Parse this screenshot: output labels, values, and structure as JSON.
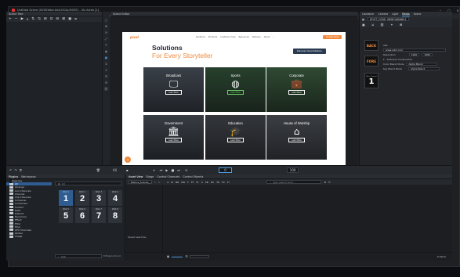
{
  "window": {
    "title": "Untitled Scene (SVGEditor.txt/LOCAL/HOST) - Viz Artist [1]",
    "controls": [
      "–",
      "□",
      "✕"
    ]
  },
  "menubar": {
    "workspace": "Workspace: Default",
    "items": [
      "Import",
      "Archive",
      "Post",
      "Config",
      "On Air"
    ]
  },
  "scene_tree": {
    "title": "Scene Tree",
    "toolbar_icons": [
      "+",
      "−",
      "▶",
      "⏸",
      "⇅",
      "⇆",
      "⊞",
      "⊡",
      "⊟",
      "⊠",
      "▣",
      "⌗"
    ]
  },
  "scene_editor": {
    "title": "Scene Editor"
  },
  "website": {
    "logo": "pixel",
    "nav": [
      "Solutions",
      "Products",
      "Customer Care",
      "Resources",
      "Partners",
      "About"
    ],
    "header_button": "Contact Sales",
    "hero_title": "Solutions",
    "hero_subtitle": "For Every Storyteller",
    "hero_button": "Discover more Solutions",
    "cards": [
      {
        "caption": "Broadcast",
        "icon": "monitor-icon",
        "glyph": "🖵",
        "button": "Learn More"
      },
      {
        "caption": "Sports",
        "icon": "basketball-icon",
        "glyph": "◍",
        "button": "Learn More"
      },
      {
        "caption": "Corporate",
        "icon": "briefcase-icon",
        "glyph": "💼",
        "button": "Learn More"
      },
      {
        "caption": "Government",
        "icon": "institution-icon",
        "glyph": "🏛",
        "button": "Learn More"
      },
      {
        "caption": "Education",
        "icon": "graduation-cap-icon",
        "glyph": "🎓",
        "button": "Learn More"
      },
      {
        "caption": "House of Worship",
        "icon": "house-icon",
        "glyph": "⌂",
        "button": "Learn More"
      }
    ],
    "back_to_top": "↑"
  },
  "right_panel": {
    "tabs": [
      "Container",
      "Camera",
      "Light",
      "Media",
      "Scene"
    ],
    "active_tab": "Media",
    "path": "ROOT_CODE: WEBCHANNEL1",
    "url_label": "URL",
    "url_value": "www.vizrt.com",
    "resolution_label": "Resolution",
    "resolution_w": "1920",
    "resolution_h": "1080",
    "composition_label": "Software Composition",
    "color_blend_label": "Color Blend Mode",
    "color_blend_value": "Alpha Blend",
    "key_blend_label": "Key Blend Mode",
    "key_blend_value": "Alpha Blend",
    "badges": [
      "BACK",
      "FORE",
      "1"
    ],
    "badge_main_layer": "Main Channel"
  },
  "timeline": {
    "field_all": "All",
    "field_frames": "0",
    "field_fps": "100"
  },
  "bottom_left": {
    "tabs": [
      "Plugins",
      "Workspace"
    ],
    "categories_label": "Categories",
    "all_label": "All",
    "tree": [
      "Arrange",
      "Aux Channels",
      "Channel",
      "Clip Channels",
      "Container",
      "Containers",
      "Control",
      "Data",
      "Default",
      "Dynamics",
      "Effect",
      "Filter",
      "Flow",
      "GFX Channels",
      "Global",
      "Image"
    ],
    "filter_value": "All",
    "search_value": "web",
    "count": "8 Plugins found",
    "tiles": [
      {
        "name": "Web 1",
        "num": "1"
      },
      {
        "name": "Web 2",
        "num": "2"
      },
      {
        "name": "Web 3",
        "num": "3"
      },
      {
        "name": "Web 4",
        "num": "4"
      },
      {
        "name": "Web 5",
        "num": "5"
      },
      {
        "name": "Web 6",
        "num": "6"
      },
      {
        "name": "Web 7",
        "num": "7"
      },
      {
        "name": "Web 8",
        "num": "8"
      }
    ]
  },
  "bottom_right": {
    "tabs": [
      "Asset View",
      "Stage",
      "Control Channels",
      "Control Objects"
    ],
    "path": "Nature_Scenes_...",
    "letters": [
      "A",
      "M",
      "NR",
      "MO",
      "F",
      "FF",
      "FL",
      "A",
      "SB",
      "DV",
      "TR",
      "FC",
      "FI"
    ],
    "search_placeholder": "Type search term...",
    "saved_searches": "Saved searches",
    "item_count": "0 items"
  }
}
